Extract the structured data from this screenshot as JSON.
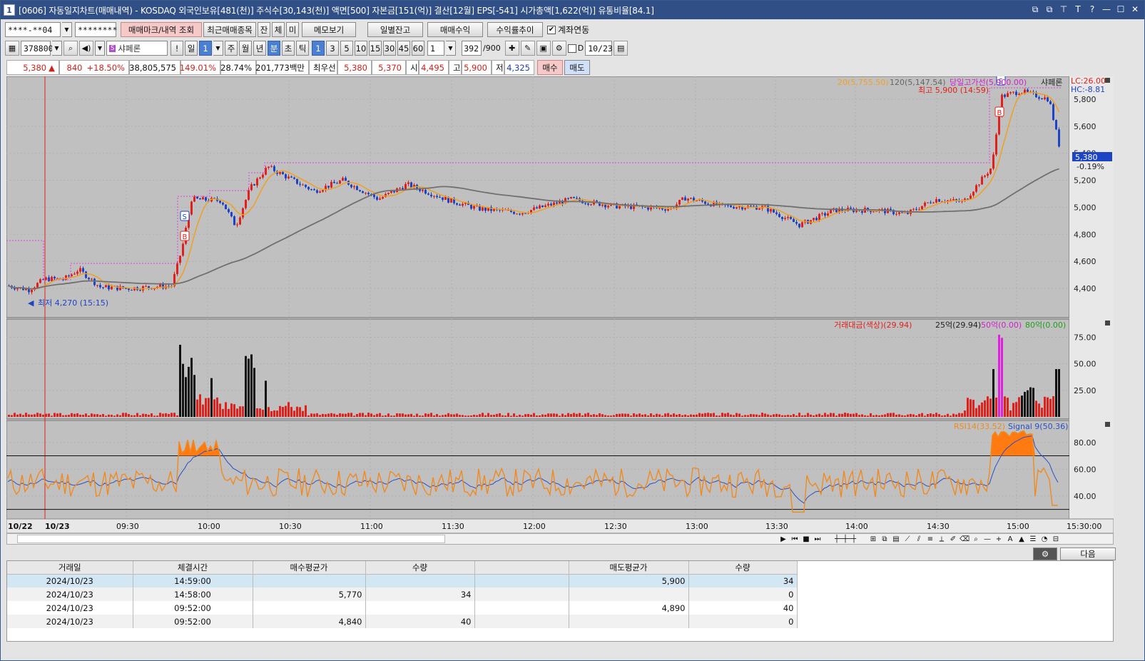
{
  "title": {
    "text": "[0606] 자동일지차트(매매내역) - KOSDAQ 외국인보유[481(천)] 주식수[30,143(천)] 액면[500] 자본금[151(억)] 결산[12월] EPS[-541] 시가총액[1,622(억)] 유통비율[84.1]",
    "app_number": "1",
    "window_icons": [
      "⧉",
      "⧉",
      "⊤",
      "T",
      "?",
      "—",
      "☐",
      "✕"
    ]
  },
  "toolbar1": {
    "account": "****-**04",
    "password": "********",
    "btn_mark": "매매마크/내역 조회",
    "btn_recent": "최근매매종목",
    "btn_jan": "잔",
    "btn_che": "체",
    "btn_mi": "미",
    "btn_memo": "메모보기",
    "btn_daily": "일별잔고",
    "btn_profit": "매매수익",
    "btn_yield": "수익률추이",
    "chk_link": "계좌연동"
  },
  "toolbar2": {
    "code": "378800",
    "name": "샤페론",
    "excl": "!",
    "periods": [
      "일",
      "1",
      "주",
      "월",
      "년",
      "분",
      "초",
      "틱"
    ],
    "intervals": [
      "1",
      "3",
      "5",
      "10",
      "15",
      "30",
      "45",
      "60"
    ],
    "unit_value": "1",
    "count": "392",
    "count_max": "/900",
    "d_label": "D",
    "date": "10/23"
  },
  "quote": {
    "price": "5,380",
    "arrow": "▲",
    "change": "840",
    "change_pct": "+18.50%",
    "volume": "38,805,575",
    "vol_ratio": "149.01%",
    "turnover": "28.74%",
    "amount": "201,773백만",
    "best_label": "최우선",
    "ask": "5,380",
    "bid": "5,370",
    "open_label": "시",
    "open": "4,495",
    "high_label": "고",
    "high": "5,900",
    "low_label": "저",
    "low": "4,325",
    "buy": "매수",
    "sell": "매도"
  },
  "chart_labels": {
    "ma20": "20(5,755.50)",
    "ma120": "120(5,147.54)",
    "day_high_line": "당일고가선(5,900.00)",
    "stock_name": "샤페론",
    "lc": "LC:26.00",
    "hc": "HC:-8.81",
    "high_note": "최고 5,900 (14:59)",
    "low_note": "최저 4,270 (15:15)",
    "cur_price": "5,380",
    "cur_pct": "-0.19%",
    "vol_title": "거래대금(색상)(29.94)",
    "vol_25": "25억(29.94)",
    "vol_50": "50억(0.00)",
    "vol_80": "80억(0.00)",
    "rsi_title": "RSI14(33.52)",
    "rsi_signal": "Signal 9(50.36)",
    "mark_s": "S",
    "mark_b": "B",
    "price_ticks": [
      "5,800",
      "5,600",
      "5,400",
      "5,200",
      "5,000",
      "4,800",
      "4,600",
      "4,400"
    ],
    "vol_ticks": [
      "75.00",
      "50.00",
      "25.00"
    ],
    "rsi_ticks": [
      "80.00",
      "60.00",
      "40.00"
    ],
    "time_ticks": [
      "10/22",
      "10/23",
      "09:30",
      "10:00",
      "10:30",
      "11:00",
      "11:30",
      "12:00",
      "12:30",
      "13:00",
      "13:30",
      "14:00",
      "14:30",
      "15:00",
      "15:30:00"
    ]
  },
  "bottom": {
    "next": "다음",
    "headers": [
      "거래일",
      "체결시간",
      "매수평균가",
      "수량",
      "",
      "매도평균가",
      "수량"
    ],
    "rows": [
      [
        "2024/10/23",
        "14:59:00",
        "",
        "",
        "",
        "5,900",
        "34"
      ],
      [
        "2024/10/23",
        "14:58:00",
        "5,770",
        "34",
        "",
        "",
        "0"
      ],
      [
        "2024/10/23",
        "09:52:00",
        "",
        "",
        "",
        "4,890",
        "40"
      ],
      [
        "2024/10/23",
        "09:52:00",
        "4,840",
        "40",
        "",
        "",
        "0"
      ]
    ]
  },
  "colors": {
    "title_bg": "#2f4f86",
    "chart_bg": "#c0c0c0",
    "up": "#e0201a",
    "down": "#1d44c4",
    "ma20": "#f0a020",
    "ma120": "#707070",
    "high_line": "#e040e0",
    "rsi": "#f08a20",
    "signal": "#2850c8"
  }
}
